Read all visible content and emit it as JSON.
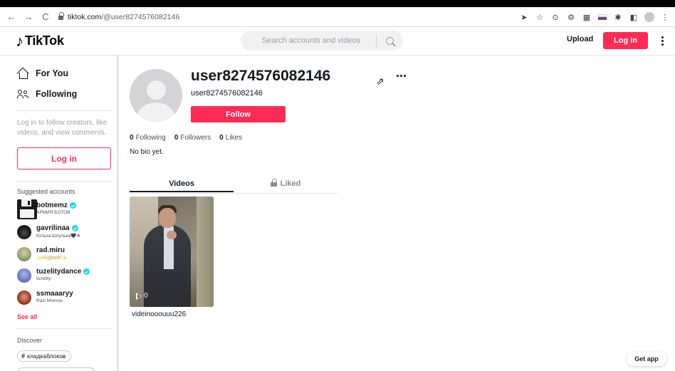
{
  "browser": {
    "url_host": "tiktok.com",
    "url_path": "/@user8274576082146"
  },
  "header": {
    "logo_text": "TikTok",
    "search_placeholder": "Search accounts and videos",
    "upload_label": "Upload",
    "login_label": "Log in"
  },
  "sidebar": {
    "nav": [
      {
        "label": "For You",
        "icon": "home-icon"
      },
      {
        "label": "Following",
        "icon": "people-icon"
      }
    ],
    "login_prompt": "Log in to follow creators, like videos, and view comments.",
    "login_label": "Log in",
    "suggested_title": "Suggested accounts",
    "accounts": [
      {
        "name": "botmemz",
        "sub": "АРМИЯ БОТОВ",
        "verified": true
      },
      {
        "name": "gavrilinaa",
        "sub": "Юлька Шпулька🖤❄",
        "verified": true
      },
      {
        "name": "rad.miru",
        "sub": "✨РАДМИР✨",
        "verified": false
      },
      {
        "name": "tuzelitydance",
        "sub": "tuzelity",
        "verified": true
      },
      {
        "name": "ssmaaaryy",
        "sub": "Razi Monroe",
        "verified": false
      }
    ],
    "see_all": "See all",
    "discover_title": "Discover",
    "tags": [
      {
        "label": "кладкаблоков"
      }
    ]
  },
  "profile": {
    "username": "user8274576082146",
    "subname": "user8274576082146",
    "follow_label": "Follow",
    "stats": [
      {
        "value": "0",
        "label": "Following"
      },
      {
        "value": "0",
        "label": "Followers"
      },
      {
        "value": "0",
        "label": "Likes"
      }
    ],
    "bio": "No bio yet.",
    "tabs": [
      {
        "label": "Videos",
        "active": true
      },
      {
        "label": "Liked",
        "active": false
      }
    ],
    "videos": [
      {
        "views": "0",
        "caption": "videinooouuu226"
      }
    ]
  },
  "get_app_label": "Get app",
  "colors": {
    "accent": "#fe2c55",
    "text": "#161823",
    "verified": "#20d5ec"
  }
}
